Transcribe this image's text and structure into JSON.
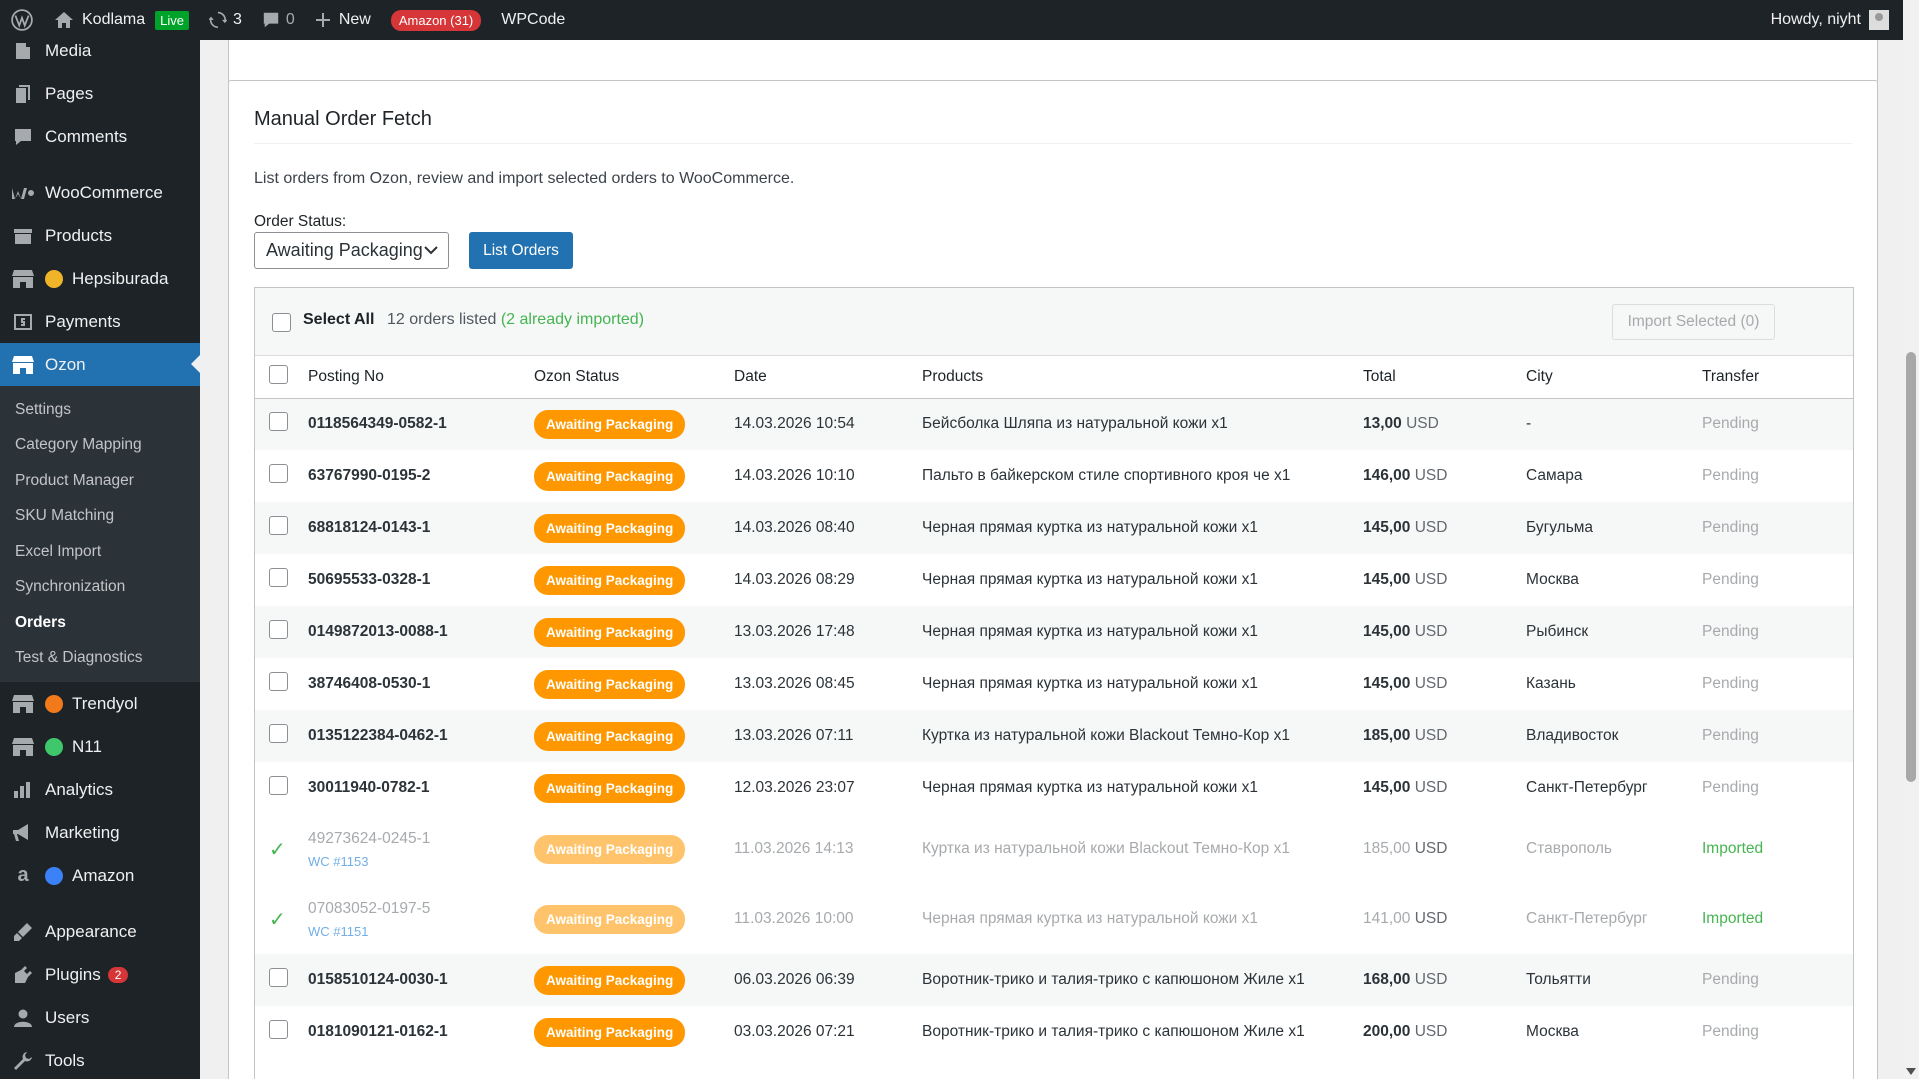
{
  "adminbar": {
    "site_name": "Kodlama",
    "live_label": "Live",
    "updates_count": "3",
    "comments_count": "0",
    "new_label": "New",
    "amazon_label": "Amazon (31)",
    "wpcode_label": "WPCode",
    "howdy": "Howdy, niyht"
  },
  "sidebar": {
    "media": "Media",
    "pages": "Pages",
    "comments": "Comments",
    "woocommerce": "WooCommerce",
    "products": "Products",
    "hepsiburada": "Hepsiburada",
    "payments": "Payments",
    "ozon": "Ozon",
    "submenu": [
      "Settings",
      "Category Mapping",
      "Product Manager",
      "SKU Matching",
      "Excel Import",
      "Synchronization",
      "Orders",
      "Test & Diagnostics"
    ],
    "trendyol": "Trendyol",
    "n11": "N11",
    "analytics": "Analytics",
    "marketing": "Marketing",
    "amazon": "Amazon",
    "appearance": "Appearance",
    "plugins": "Plugins",
    "plugins_count": "2",
    "users": "Users",
    "tools": "Tools",
    "colors": {
      "hepsiburada_dot": "#f0b429",
      "trendyol_dot": "#f27a1a",
      "n11_dot": "#3ec86b",
      "amazon_dot": "#3b82f6"
    }
  },
  "page": {
    "title": "Manual Order Fetch",
    "description": "List orders from Ozon, review and import selected orders to WooCommerce.",
    "status_label": "Order Status:",
    "status_selected": "Awaiting Packaging",
    "list_button": "List Orders",
    "select_all": "Select All",
    "listed_text": "12 orders listed",
    "imported_note": "(2 already imported)",
    "import_button": "Import Selected (0)"
  },
  "table": {
    "headers": [
      "Posting No",
      "Ozon Status",
      "Date",
      "Products",
      "Total",
      "City",
      "Transfer"
    ],
    "rows": [
      {
        "posting": "0118564349-0582-1",
        "status": "Awaiting Packaging",
        "date": "14.03.2026 10:54",
        "product": "Бейсболка Шляпа из натуральной кожи x1",
        "total": "13,00",
        "currency": "USD",
        "city": "-",
        "transfer": "Pending"
      },
      {
        "posting": "63767990-0195-2",
        "status": "Awaiting Packaging",
        "date": "14.03.2026 10:10",
        "product": "Пальто в байкерском стиле спортивного кроя че x1",
        "total": "146,00",
        "currency": "USD",
        "city": "Самара",
        "transfer": "Pending"
      },
      {
        "posting": "68818124-0143-1",
        "status": "Awaiting Packaging",
        "date": "14.03.2026 08:40",
        "product": "Черная прямая куртка из натуральной кожи x1",
        "total": "145,00",
        "currency": "USD",
        "city": "Бугульма",
        "transfer": "Pending"
      },
      {
        "posting": "50695533-0328-1",
        "status": "Awaiting Packaging",
        "date": "14.03.2026 08:29",
        "product": "Черная прямая куртка из натуральной кожи x1",
        "total": "145,00",
        "currency": "USD",
        "city": "Москва",
        "transfer": "Pending"
      },
      {
        "posting": "0149872013-0088-1",
        "status": "Awaiting Packaging",
        "date": "13.03.2026 17:48",
        "product": "Черная прямая куртка из натуральной кожи x1",
        "total": "145,00",
        "currency": "USD",
        "city": "Рыбинск",
        "transfer": "Pending"
      },
      {
        "posting": "38746408-0530-1",
        "status": "Awaiting Packaging",
        "date": "13.03.2026 08:45",
        "product": "Черная прямая куртка из натуральной кожи x1",
        "total": "145,00",
        "currency": "USD",
        "city": "Казань",
        "transfer": "Pending"
      },
      {
        "posting": "0135122384-0462-1",
        "status": "Awaiting Packaging",
        "date": "13.03.2026 07:11",
        "product": "Куртка из натуральной кожи Blackout Темно-Кор x1",
        "total": "185,00",
        "currency": "USD",
        "city": "Владивосток",
        "transfer": "Pending"
      },
      {
        "posting": "30011940-0782-1",
        "status": "Awaiting Packaging",
        "date": "12.03.2026 23:07",
        "product": "Черная прямая куртка из натуральной кожи x1",
        "total": "145,00",
        "currency": "USD",
        "city": "Санкт-Петербург",
        "transfer": "Pending"
      },
      {
        "posting": "49273624-0245-1",
        "wc": "WC #1153",
        "status": "Awaiting Packaging",
        "date": "11.03.2026 14:13",
        "product": "Куртка из натуральной кожи Blackout Темно-Кор x1",
        "total": "185,00",
        "currency": "USD",
        "city": "Ставрополь",
        "transfer": "Imported"
      },
      {
        "posting": "07083052-0197-5",
        "wc": "WC #1151",
        "status": "Awaiting Packaging",
        "date": "11.03.2026 10:00",
        "product": "Черная прямая куртка из натуральной кожи x1",
        "total": "141,00",
        "currency": "USD",
        "city": "Санкт-Петербург",
        "transfer": "Imported"
      },
      {
        "posting": "0158510124-0030-1",
        "status": "Awaiting Packaging",
        "date": "06.03.2026 06:39",
        "product": "Воротник-трико и талия-трико с капюшоном Жиле x1",
        "total": "168,00",
        "currency": "USD",
        "city": "Тольятти",
        "transfer": "Pending"
      },
      {
        "posting": "0181090121-0162-1",
        "status": "Awaiting Packaging",
        "date": "03.03.2026 07:21",
        "product": "Воротник-трико и талия-трико с капюшоном Жиле x1",
        "total": "200,00",
        "currency": "USD",
        "city": "Москва",
        "transfer": "Pending"
      }
    ]
  },
  "icons": [
    "wordpress-icon",
    "home-icon",
    "updates-icon",
    "comment-icon",
    "plus-icon",
    "media-icon",
    "pages-icon",
    "comments-icon",
    "woo-icon",
    "products-icon",
    "store-icon",
    "payments-icon",
    "analytics-icon",
    "marketing-icon",
    "amazon-icon",
    "appearance-icon",
    "plugins-icon",
    "users-icon",
    "tools-icon",
    "chevron-down-icon",
    "check-icon"
  ]
}
